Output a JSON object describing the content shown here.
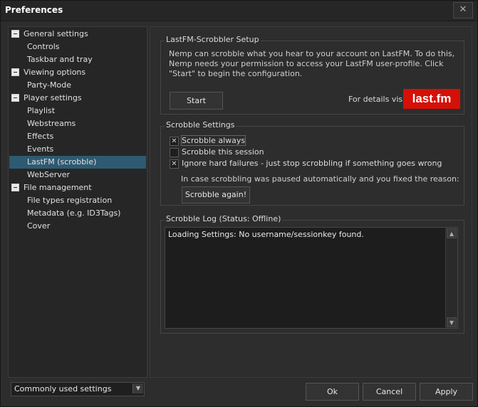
{
  "window": {
    "title": "Preferences",
    "close_glyph": "✕"
  },
  "tree": {
    "items": [
      {
        "label": "General settings",
        "type": "parent"
      },
      {
        "label": "Controls",
        "type": "child"
      },
      {
        "label": "Taskbar and tray",
        "type": "child"
      },
      {
        "label": "Viewing options",
        "type": "parent"
      },
      {
        "label": "Party-Mode",
        "type": "child"
      },
      {
        "label": "Player settings",
        "type": "parent"
      },
      {
        "label": "Playlist",
        "type": "child"
      },
      {
        "label": "Webstreams",
        "type": "child"
      },
      {
        "label": "Effects",
        "type": "child"
      },
      {
        "label": "Events",
        "type": "child"
      },
      {
        "label": "LastFM (scrobble)",
        "type": "child",
        "selected": true
      },
      {
        "label": "WebServer",
        "type": "child"
      },
      {
        "label": "File management",
        "type": "parent"
      },
      {
        "label": "File types registration",
        "type": "child"
      },
      {
        "label": "Metadata (e.g. ID3Tags)",
        "type": "child"
      },
      {
        "label": "Cover",
        "type": "child"
      }
    ]
  },
  "filter_combo": {
    "value": "Commonly used settings"
  },
  "setup": {
    "title": "LastFM-Scrobbler Setup",
    "description": "Nemp can scrobble what you hear to your account on LastFM. To do this, Nemp needs your permission to access your LastFM user-profile. Click \"Start\" to begin the configuration.",
    "start_button": "Start",
    "details_label": "For details visit",
    "logo_text": "last.fm"
  },
  "scrobble": {
    "title": "Scrobble Settings",
    "options": [
      {
        "label": "Scrobble always",
        "checked": true
      },
      {
        "label": "Scrobble this session",
        "checked": false
      },
      {
        "label": "Ignore hard failures - just stop scrobbling if something goes wrong",
        "checked": true
      }
    ],
    "paused_note": "In case scrobbling was paused automatically and you fixed the reason:",
    "again_button": "Scrobble again!"
  },
  "log": {
    "title": "Scrobble Log (Status: Offline)",
    "text": "Loading Settings: No username/sessionkey found."
  },
  "footer": {
    "ok": "Ok",
    "cancel": "Cancel",
    "apply": "Apply"
  }
}
